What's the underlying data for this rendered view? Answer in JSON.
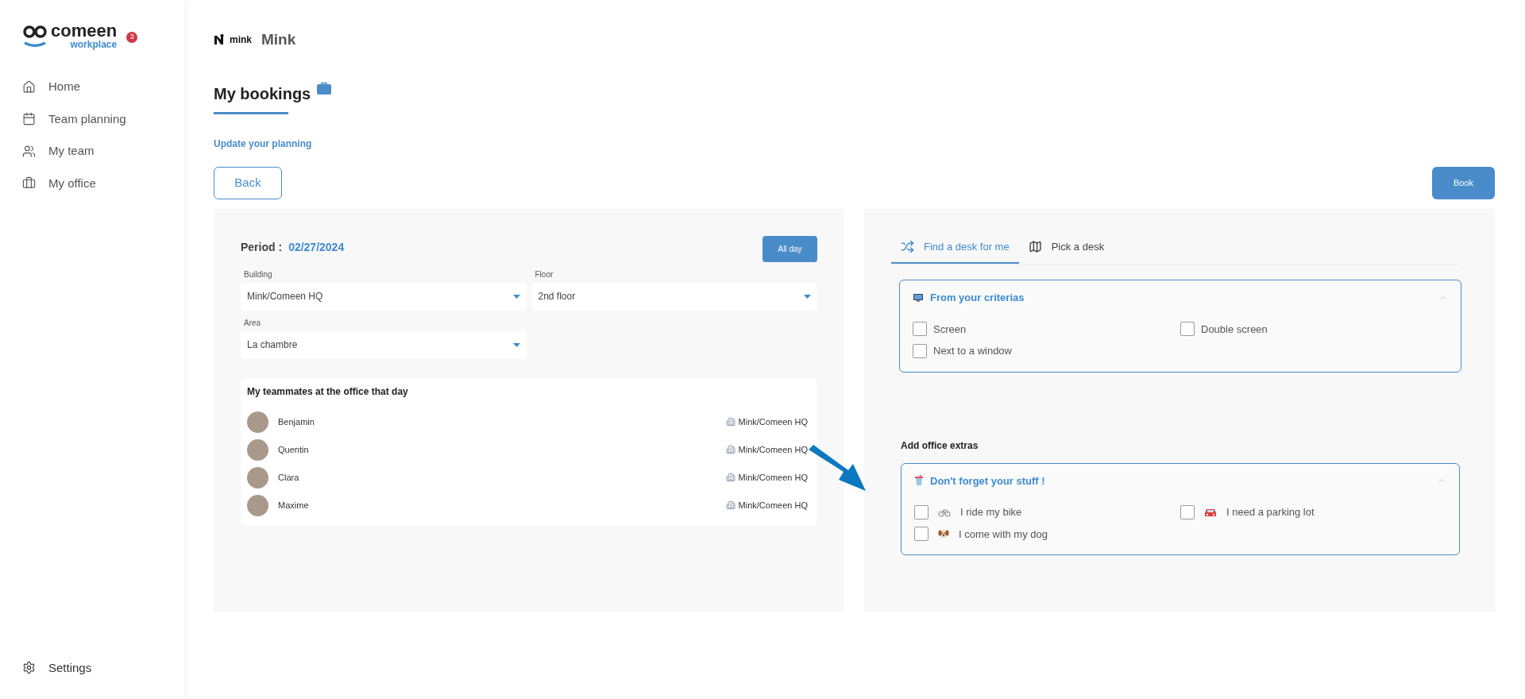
{
  "sidebar": {
    "logo": {
      "name": "comeen",
      "sub": "workplace"
    },
    "notification_count": "3",
    "items": [
      {
        "label": "Home",
        "kind": "home",
        "selected": false
      },
      {
        "label": "Team planning",
        "kind": "calendar",
        "selected": false
      },
      {
        "label": "My team",
        "kind": "users",
        "selected": false
      },
      {
        "label": "My office",
        "kind": "briefcase",
        "selected": false
      }
    ],
    "footer": {
      "label": "Settings",
      "kind": "settings"
    }
  },
  "header": {
    "company_logo": "mink",
    "company_name": "Mink"
  },
  "page": {
    "title": "My bookings",
    "link": "Update your planning",
    "back_button": "Back",
    "book_button": "Book"
  },
  "booking_form": {
    "period_label": "Period :",
    "period_value": "02/27/2024",
    "all_day_button": "All day",
    "fields": [
      {
        "label": "Building",
        "value": "Mink/Comeen HQ"
      },
      {
        "label": "Floor",
        "value": "2nd floor"
      },
      {
        "label": "Area",
        "value": "La chambre"
      }
    ],
    "teammates": {
      "title": "My teammates at the office that day",
      "rows": [
        {
          "name": "Benjamin",
          "location": "Mink/Comeen HQ"
        },
        {
          "name": "Quentin",
          "location": "Mink/Comeen HQ"
        },
        {
          "name": "Clara",
          "location": "Mink/Comeen HQ"
        },
        {
          "name": "Maxime",
          "location": "Mink/Comeen HQ"
        }
      ]
    }
  },
  "desk_panel": {
    "tabs": [
      {
        "label": "Find a desk for me",
        "kind": "shuffle",
        "selected": true
      },
      {
        "label": "Pick a desk",
        "kind": "map",
        "selected": false
      }
    ],
    "criteria": {
      "title": "From your criterias",
      "kind": "monitor",
      "expanded": true,
      "options": [
        {
          "label": "Screen",
          "checked": false
        },
        {
          "label": "Double screen",
          "checked": false
        },
        {
          "label": "Next to a window",
          "checked": false
        }
      ]
    },
    "extras_heading": "Add office extras",
    "extras": {
      "title": "Don't forget your stuff !",
      "kind": "cup",
      "expanded": true,
      "options": [
        {
          "label": "I ride my bike",
          "kind": "bike",
          "checked": false
        },
        {
          "label": "I need a parking lot",
          "kind": "car",
          "checked": false
        },
        {
          "label": "I come with my dog",
          "kind": "dog",
          "checked": false
        }
      ]
    }
  }
}
